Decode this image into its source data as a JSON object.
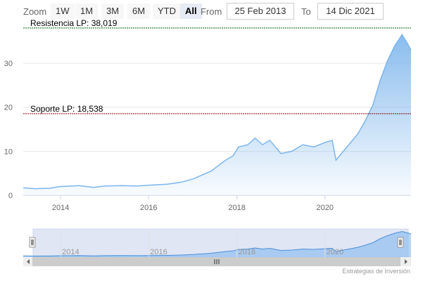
{
  "toolbar": {
    "zoom_label": "Zoom",
    "buttons": [
      {
        "label": "1W",
        "active": false
      },
      {
        "label": "1M",
        "active": false
      },
      {
        "label": "3M",
        "active": false
      },
      {
        "label": "6M",
        "active": false
      },
      {
        "label": "YTD",
        "active": false
      },
      {
        "label": "All",
        "active": true
      }
    ],
    "from_label": "From",
    "from_value": "25 Feb 2013",
    "to_label": "To",
    "to_value": "14 Dic 2021"
  },
  "credit": "Estrategias de Inversión",
  "colors": {
    "series": "#7cb5ec",
    "resistance": "#006400",
    "support": "#8b0000"
  },
  "chart_data": {
    "type": "area",
    "x_range": [
      "2013-02-25",
      "2021-12-14"
    ],
    "ylim": [
      0,
      38
    ],
    "y_ticks": [
      0,
      10,
      20,
      30
    ],
    "x_ticks": [
      "2014",
      "2016",
      "2018",
      "2020"
    ],
    "nav_ticks": [
      "2014",
      "2016",
      "2018",
      "2020"
    ],
    "grid": true,
    "plot_lines": [
      {
        "label": "Resistencia LP: 38,019",
        "value": 38.019,
        "color": "#006400"
      },
      {
        "label": "Soporte LP: 18,538",
        "value": 18.538,
        "color": "#8b0000"
      }
    ],
    "series": [
      {
        "points": [
          [
            "2013-02-25",
            1.7
          ],
          [
            "2013-06-01",
            1.5
          ],
          [
            "2013-10-01",
            1.6
          ],
          [
            "2014-01-01",
            2.0
          ],
          [
            "2014-06-01",
            2.2
          ],
          [
            "2014-10-01",
            1.8
          ],
          [
            "2015-01-01",
            2.1
          ],
          [
            "2015-06-01",
            2.2
          ],
          [
            "2015-10-01",
            2.1
          ],
          [
            "2016-01-01",
            2.3
          ],
          [
            "2016-06-01",
            2.5
          ],
          [
            "2016-10-01",
            3.0
          ],
          [
            "2017-01-01",
            3.7
          ],
          [
            "2017-06-01",
            5.5
          ],
          [
            "2017-10-01",
            8.0
          ],
          [
            "2017-12-01",
            9.0
          ],
          [
            "2018-01-15",
            11.0
          ],
          [
            "2018-04-01",
            11.5
          ],
          [
            "2018-06-01",
            13.0
          ],
          [
            "2018-08-01",
            11.5
          ],
          [
            "2018-10-01",
            12.5
          ],
          [
            "2019-01-01",
            9.5
          ],
          [
            "2019-04-01",
            10.0
          ],
          [
            "2019-07-01",
            11.5
          ],
          [
            "2019-10-01",
            11.0
          ],
          [
            "2020-01-01",
            12.0
          ],
          [
            "2020-03-01",
            12.5
          ],
          [
            "2020-04-01",
            8.0
          ],
          [
            "2020-07-01",
            11.0
          ],
          [
            "2020-10-01",
            14.0
          ],
          [
            "2020-12-01",
            17.0
          ],
          [
            "2021-02-01",
            20.5
          ],
          [
            "2021-04-01",
            26.0
          ],
          [
            "2021-06-01",
            30.5
          ],
          [
            "2021-08-01",
            34.0
          ],
          [
            "2021-10-01",
            36.5
          ],
          [
            "2021-11-15",
            34.5
          ],
          [
            "2021-12-14",
            33.0
          ]
        ]
      }
    ]
  }
}
